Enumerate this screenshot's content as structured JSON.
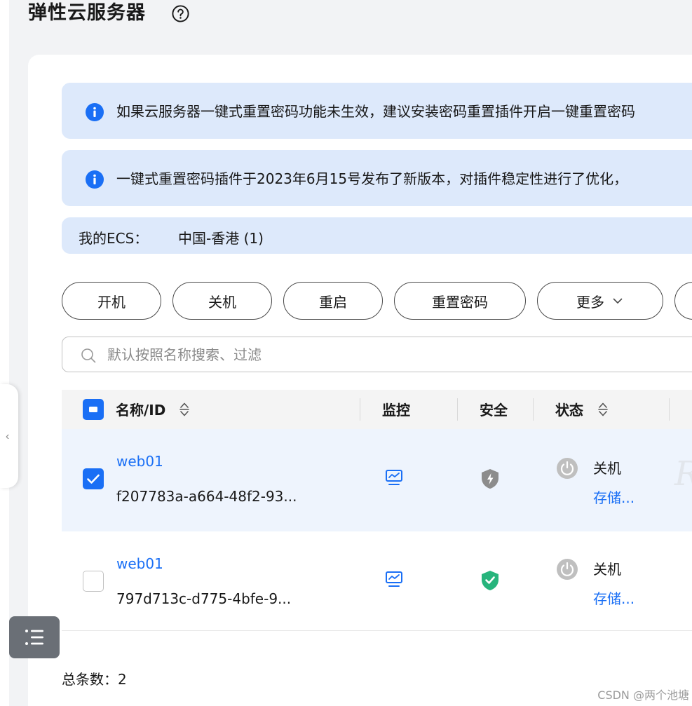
{
  "page": {
    "title": "弹性云服务器"
  },
  "notices": [
    {
      "text": "如果云服务器一键式重置密码功能未生效，建议安装密码重置插件开启一键重置密码"
    },
    {
      "text": "一键式重置密码插件于2023年6月15号发布了新版本，对插件稳定性进行了优化，"
    }
  ],
  "region": {
    "label": "我的ECS：",
    "value": "中国-香港 (1)"
  },
  "toolbar": {
    "start_label": "开机",
    "stop_label": "关机",
    "restart_label": "重启",
    "reset_password_label": "重置密码",
    "more_label": "更多"
  },
  "search": {
    "placeholder": "默认按照名称搜索、过滤"
  },
  "table": {
    "headers": {
      "name_id": "名称/ID",
      "monitor": "监控",
      "security": "安全",
      "status": "状态"
    },
    "rows": [
      {
        "name": "web01",
        "id": "f207783a-a664-48f2-93...",
        "status": "关机",
        "storage_link": "存储...",
        "selected": true,
        "security_color": "#8c8c8c"
      },
      {
        "name": "web01",
        "id": "797d713c-d775-4bfe-9...",
        "status": "关机",
        "storage_link": "存储...",
        "selected": false,
        "security_color": "#27b47c"
      }
    ]
  },
  "footer": {
    "total": "总条数：2"
  },
  "watermark": "CSDN @两个池塘",
  "colors": {
    "accent": "#1a6ff5",
    "notice_bg": "#dde9fb",
    "selected_row": "#eef4fd",
    "safe_green": "#27b47c"
  }
}
